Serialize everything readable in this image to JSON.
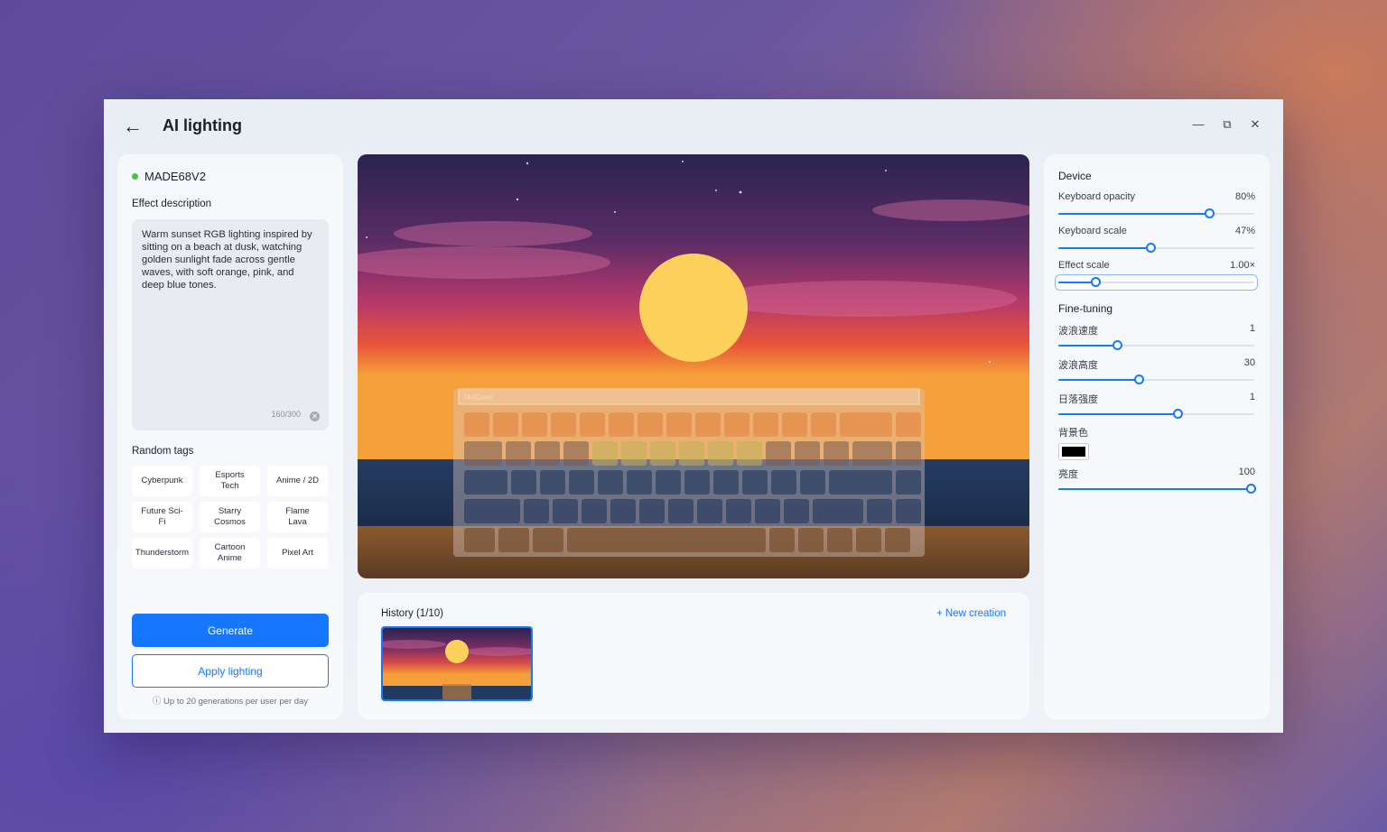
{
  "window": {
    "title": "AI lighting"
  },
  "left": {
    "device_name": "MADE68V2",
    "description_label": "Effect description",
    "description_text": "Warm sunset RGB lighting inspired by sitting on a beach at dusk, watching golden sunlight fade across gentle waves, with soft orange, pink, and deep blue tones.",
    "counter": "160/300",
    "random_tags_label": "Random tags",
    "tags": [
      "Cyberpunk",
      "Esports Tech",
      "Anime / 2D",
      "Future Sci-Fi",
      "Starry Cosmos",
      "Flame Lava",
      "Thunderstorm",
      "Cartoon Anime",
      "Pixel Art"
    ],
    "generate_label": "Generate",
    "apply_label": "Apply lighting",
    "limit_note": "ⓘ Up to 20 generations per user per day"
  },
  "preview": {
    "keyboard_brand": "MelGeek"
  },
  "history": {
    "title": "History (1/10)",
    "new_creation": "+ New creation"
  },
  "right": {
    "device_heading": "Device",
    "fine_tuning_heading": "Fine-tuning",
    "sliders": {
      "keyboard_opacity": {
        "label": "Keyboard opacity",
        "value": "80%",
        "level": 0.77
      },
      "keyboard_scale": {
        "label": "Keyboard scale",
        "value": "47%",
        "level": 0.47
      },
      "effect_scale": {
        "label": "Effect scale",
        "value": "1.00×",
        "level": 0.19
      },
      "wave_speed": {
        "label": "波浪速度",
        "value": "1",
        "level": 0.3
      },
      "wave_height": {
        "label": "波浪高度",
        "value": "30",
        "level": 0.41
      },
      "sunset_intensity": {
        "label": "日落强度",
        "value": "1",
        "level": 0.61
      },
      "brightness": {
        "label": "亮度",
        "value": "100",
        "level": 0.98
      }
    },
    "bg_color_label": "背景色",
    "bg_color": "#000000"
  },
  "colors": {
    "accent": "#1677ff",
    "online": "#4cc23a"
  }
}
